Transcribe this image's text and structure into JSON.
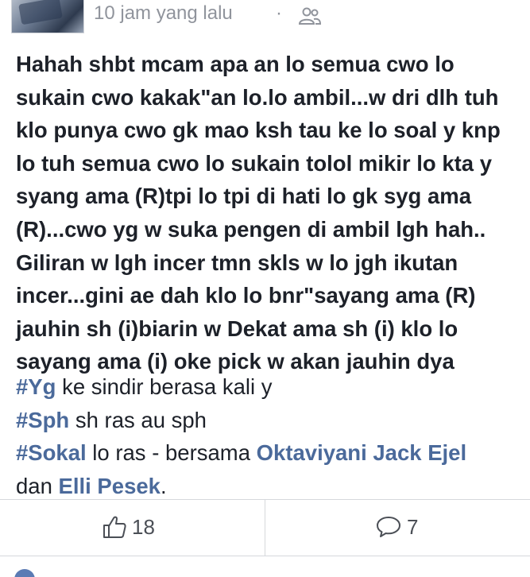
{
  "header": {
    "timestamp": "10 jam yang lalu",
    "separator": "·",
    "audience_icon": "friends-icon"
  },
  "post": {
    "lines": [
      "Hahah shbt mcam apa an lo semua cwo lo",
      "sukain cwo kakak\"an lo.lo ambil...w dri dlh tuh",
      "klo punya cwo gk mao ksh tau ke lo soal y knp",
      "lo tuh semua cwo lo sukain tolol mikir lo kta y",
      "syang ama (R)tpi lo tpi di hati lo gk syg ama",
      "(R)...cwo yg w suka pengen di ambil lgh hah..",
      "Giliran w lgh incer tmn skls w lo jgh ikutan",
      "incer...gini ae dah klo lo bnr\"sayang ama (R)",
      "jauhin sh (i)biarin w Dekat ama sh (i) klo lo",
      "sayang ama (i) oke pick w akan jauhin dya"
    ],
    "hashtag1": "#Yg",
    "hashtag1_text": " ke sindir berasa kali y",
    "hashtag2": "#Sph",
    "hashtag2_text": " sh ras au sph",
    "hashtag3": "#Sokal",
    "hashtag3_text": " lo ras - bersama ",
    "mention1": "Oktaviyani Jack Ejel",
    "conjunction": "dan ",
    "mention2": "Elli Pesek",
    "end_period": "."
  },
  "actions": {
    "like_count": "18",
    "comment_count": "7"
  },
  "colors": {
    "link": "#4b6a9b",
    "text": "#1d2129",
    "meta": "#90949c",
    "divider": "#d6d8dc"
  }
}
